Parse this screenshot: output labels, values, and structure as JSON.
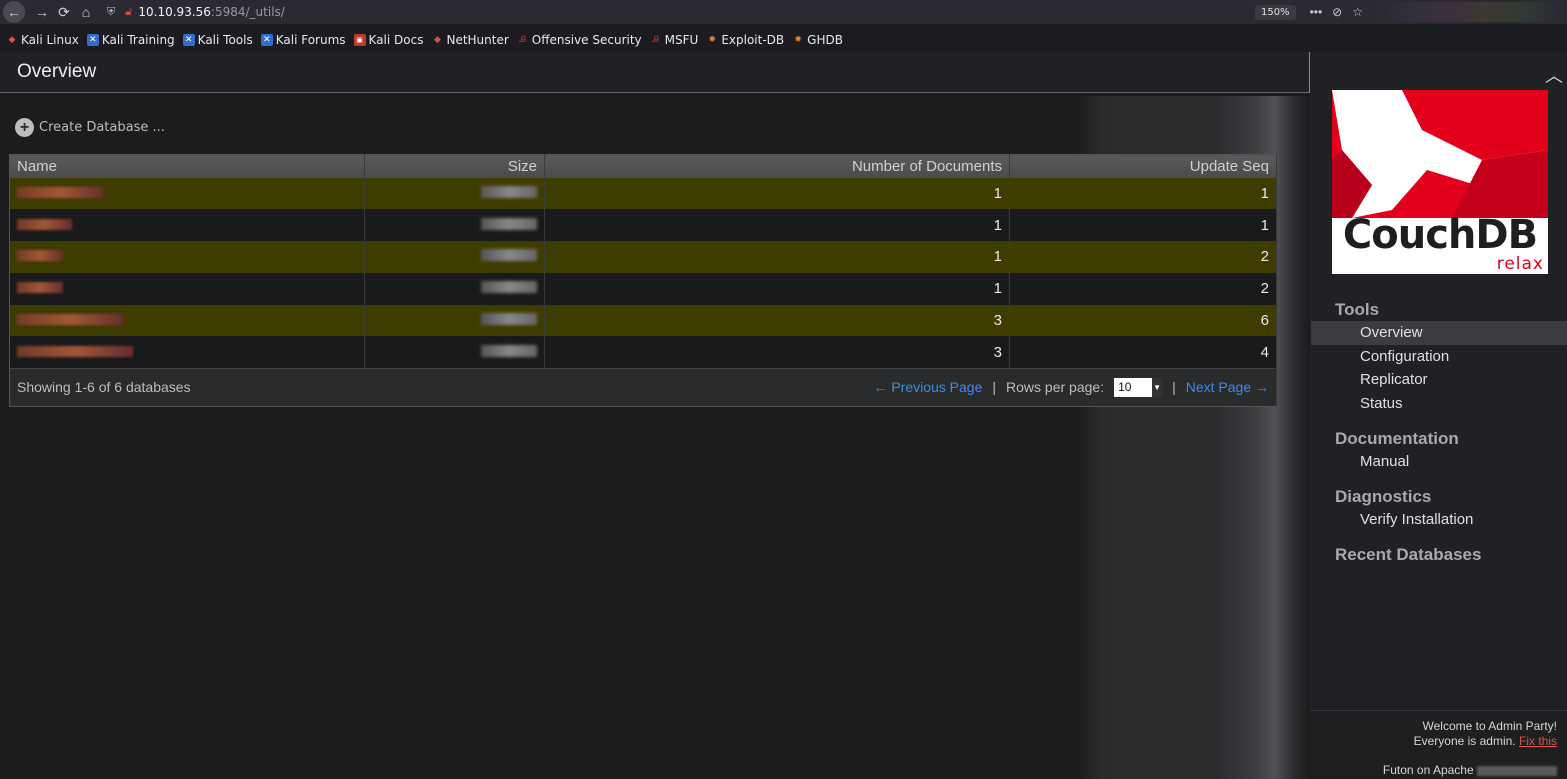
{
  "browser": {
    "url_host": "10.10.93.56",
    "url_path": ":5984/_utils/",
    "zoom": "150%",
    "bookmarks": [
      {
        "label": "Kali Linux"
      },
      {
        "label": "Kali Training"
      },
      {
        "label": "Kali Tools"
      },
      {
        "label": "Kali Forums"
      },
      {
        "label": "Kali Docs"
      },
      {
        "label": "NetHunter"
      },
      {
        "label": "Offensive Security"
      },
      {
        "label": "MSFU"
      },
      {
        "label": "Exploit-DB"
      },
      {
        "label": "GHDB"
      }
    ]
  },
  "page": {
    "title": "Overview",
    "create_label": "Create Database ...",
    "table": {
      "headers": [
        "Name",
        "Size",
        "Number of Documents",
        "Update Seq"
      ],
      "rows": [
        {
          "docs": "1",
          "seq": "1"
        },
        {
          "docs": "1",
          "seq": "1"
        },
        {
          "docs": "1",
          "seq": "2"
        },
        {
          "docs": "1",
          "seq": "2"
        },
        {
          "docs": "3",
          "seq": "6"
        },
        {
          "docs": "3",
          "seq": "4"
        }
      ]
    },
    "footer": {
      "showing": "Showing 1-6 of 6 databases",
      "prev": "← Previous Page",
      "rows_label": "Rows per page:",
      "rows_value": "10",
      "next": "Next Page →",
      "sep": "|"
    }
  },
  "sidebar": {
    "logo_text": "CouchDB",
    "logo_tagline": "relax",
    "sections": {
      "tools": {
        "title": "Tools",
        "items": [
          "Overview",
          "Configuration",
          "Replicator",
          "Status"
        ]
      },
      "documentation": {
        "title": "Documentation",
        "items": [
          "Manual"
        ]
      },
      "diagnostics": {
        "title": "Diagnostics",
        "items": [
          "Verify Installation"
        ]
      },
      "recent": {
        "title": "Recent Databases"
      }
    },
    "footer": {
      "welcome": "Welcome to Admin Party!",
      "everyone": "Everyone is admin.",
      "fix": "Fix this",
      "futon": "Futon on Apache"
    }
  },
  "colors": {
    "accent_link": "#3c8ce7",
    "row_highlight": "#3f3c00",
    "couchdb_red": "#e3001b"
  }
}
